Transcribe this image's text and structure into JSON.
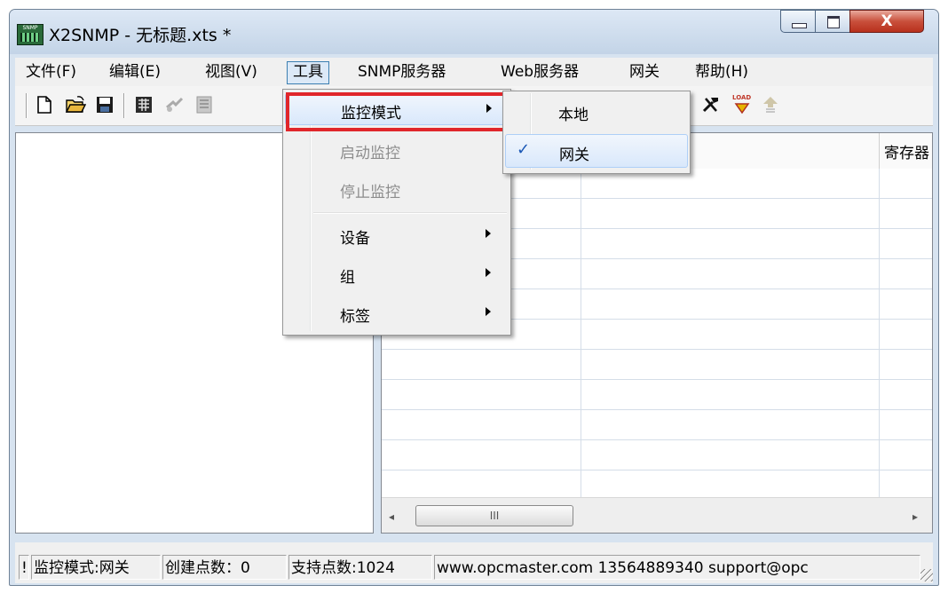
{
  "window": {
    "title": "X2SNMP - 无标题.xts *",
    "icon_text": "SNMP",
    "close_glyph": "X"
  },
  "menubar": {
    "items": [
      "文件(F)",
      "编辑(E)",
      "视图(V)",
      "工具",
      "SNMP服务器",
      "Web服务器",
      "网关",
      "帮助(H)"
    ],
    "active_index": 3
  },
  "toolbar": {
    "buttons": [
      "new-icon",
      "open-folder-icon",
      "save-icon",
      "device-icon",
      "connect-icon",
      "table-icon",
      "tools-icon",
      "load-icon",
      "upload-icon"
    ],
    "load_text": "LOAD"
  },
  "tools_menu": {
    "items": [
      {
        "label": "监控模式",
        "submenu": true,
        "enabled": true,
        "highlighted": true
      },
      {
        "label": "启动监控",
        "submenu": false,
        "enabled": false
      },
      {
        "label": "停止监控",
        "submenu": false,
        "enabled": false
      },
      {
        "label": "设备",
        "submenu": true,
        "enabled": true
      },
      {
        "label": "组",
        "submenu": true,
        "enabled": true
      },
      {
        "label": "标签",
        "submenu": true,
        "enabled": true
      }
    ]
  },
  "monitor_mode_submenu": {
    "items": [
      {
        "label": "本地",
        "checked": false
      },
      {
        "label": "网关",
        "checked": true
      }
    ],
    "check_glyph": "✓"
  },
  "grid": {
    "visible_header": "寄存器"
  },
  "hscroll": {
    "thumb_glyph": "III",
    "left_glyph": "◂",
    "right_glyph": "▸"
  },
  "statusbar": {
    "cells": [
      "!",
      "监控模式:网关",
      "创建点数：0",
      "支持点数:1024",
      "www.opcmaster.com 13564889340 support@opc"
    ]
  },
  "colors": {
    "highlight_border": "#e0262b",
    "check": "#1a57b5"
  }
}
